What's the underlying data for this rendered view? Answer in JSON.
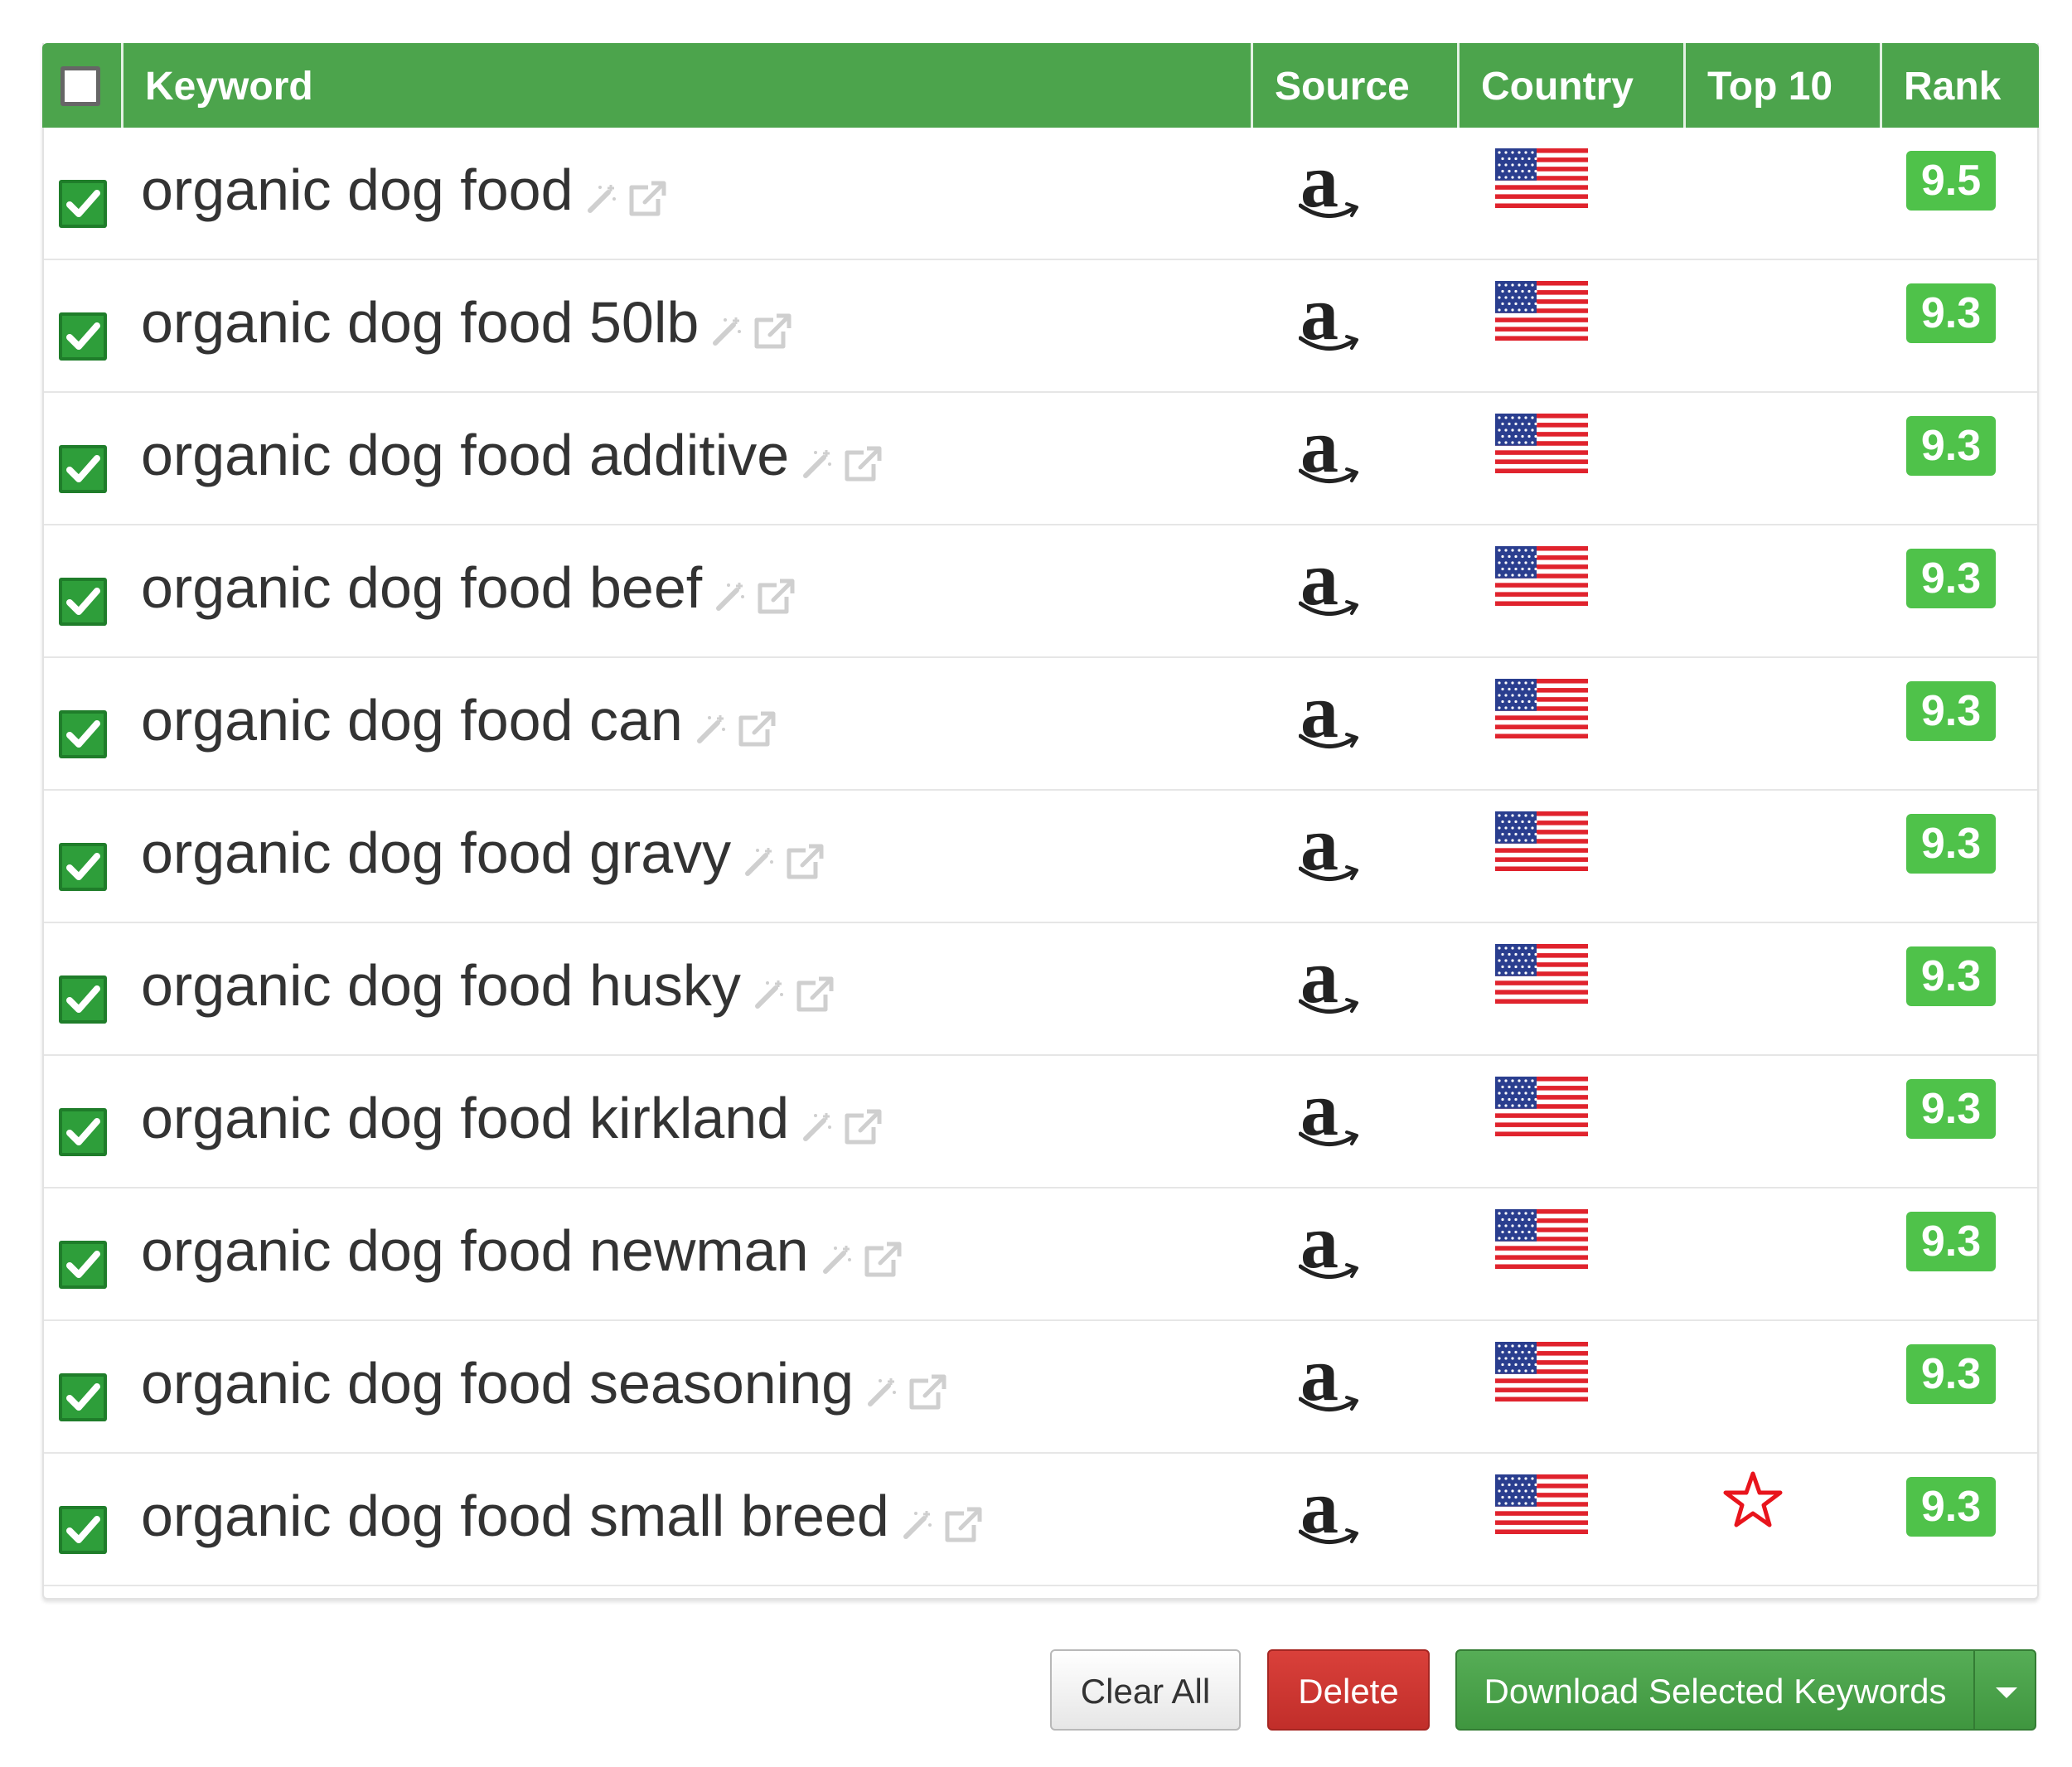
{
  "table": {
    "headers": {
      "keyword": "Keyword",
      "source": "Source",
      "country": "Country",
      "top10": "Top 10",
      "rank": "Rank"
    },
    "select_all_checked": false,
    "sort_column": "Rank",
    "sort_direction": "descending",
    "rows": [
      {
        "keyword": "organic dog food",
        "source_icon": "amazon-icon",
        "country_icon": "us-flag-icon",
        "top10": false,
        "rank": "9.5",
        "checked": true
      },
      {
        "keyword": "organic dog food 50lb",
        "source_icon": "amazon-icon",
        "country_icon": "us-flag-icon",
        "top10": false,
        "rank": "9.3",
        "checked": true
      },
      {
        "keyword": "organic dog food additive",
        "source_icon": "amazon-icon",
        "country_icon": "us-flag-icon",
        "top10": false,
        "rank": "9.3",
        "checked": true
      },
      {
        "keyword": "organic dog food beef",
        "source_icon": "amazon-icon",
        "country_icon": "us-flag-icon",
        "top10": false,
        "rank": "9.3",
        "checked": true
      },
      {
        "keyword": "organic dog food can",
        "source_icon": "amazon-icon",
        "country_icon": "us-flag-icon",
        "top10": false,
        "rank": "9.3",
        "checked": true
      },
      {
        "keyword": "organic dog food gravy",
        "source_icon": "amazon-icon",
        "country_icon": "us-flag-icon",
        "top10": false,
        "rank": "9.3",
        "checked": true
      },
      {
        "keyword": "organic dog food husky",
        "source_icon": "amazon-icon",
        "country_icon": "us-flag-icon",
        "top10": false,
        "rank": "9.3",
        "checked": true
      },
      {
        "keyword": "organic dog food kirkland",
        "source_icon": "amazon-icon",
        "country_icon": "us-flag-icon",
        "top10": false,
        "rank": "9.3",
        "checked": true
      },
      {
        "keyword": "organic dog food newman",
        "source_icon": "amazon-icon",
        "country_icon": "us-flag-icon",
        "top10": false,
        "rank": "9.3",
        "checked": true
      },
      {
        "keyword": "organic dog food seasoning",
        "source_icon": "amazon-icon",
        "country_icon": "us-flag-icon",
        "top10": false,
        "rank": "9.3",
        "checked": true
      },
      {
        "keyword": "organic dog food small breed",
        "source_icon": "amazon-icon",
        "country_icon": "us-flag-icon",
        "top10": true,
        "rank": "9.3",
        "checked": true
      }
    ]
  },
  "actions": {
    "clear_all": "Clear All",
    "delete": "Delete",
    "download": "Download Selected Keywords"
  },
  "colors": {
    "header_green": "#4ca44c",
    "rank_badge": "#4fc24a",
    "delete_red": "#c9302c",
    "top10_star": "#e8141c"
  }
}
